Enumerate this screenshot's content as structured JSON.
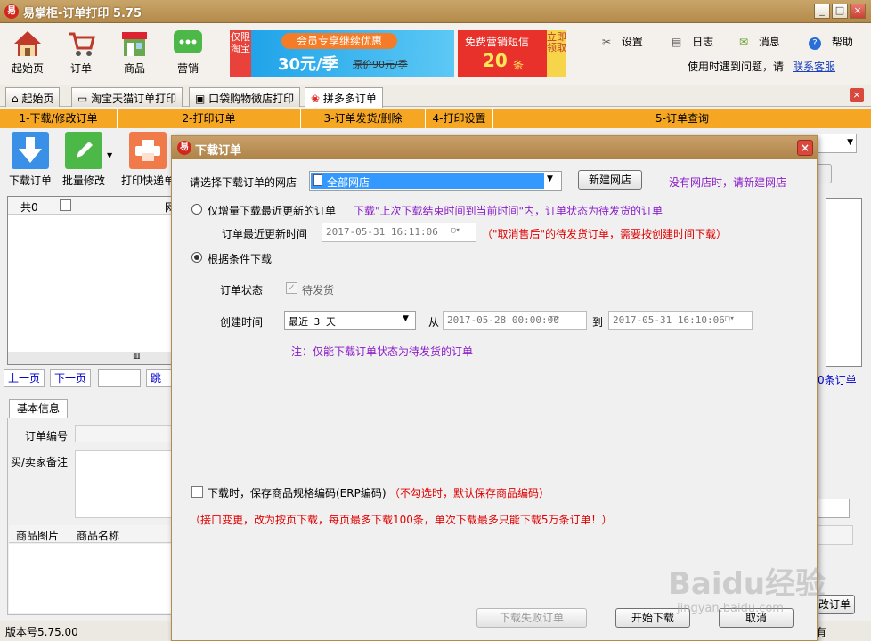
{
  "window": {
    "title": "易掌柜-订单打印 5.75",
    "logo": "易"
  },
  "toolbar": {
    "items": [
      {
        "label": "起始页",
        "icon": "house-icon"
      },
      {
        "label": "订单",
        "icon": "cart-icon"
      },
      {
        "label": "商品",
        "icon": "shop-icon"
      },
      {
        "label": "营销",
        "icon": "chat-bubble-icon"
      }
    ],
    "ad1": {
      "side": "仅限淘宝",
      "top": "会员专享继续优惠",
      "price": "30元/季",
      "orig": "原价90元/季"
    },
    "ad2": {
      "text": "免费营销短信",
      "count": "20",
      "unit": "条",
      "side": "立即领取"
    },
    "menu": {
      "settings": "设置",
      "log": "日志",
      "message": "消息",
      "help": "帮助"
    },
    "help_text": "使用时遇到问题，请",
    "contact_link": "联系客服"
  },
  "tabs": [
    {
      "label": "起始页"
    },
    {
      "label": "淘宝天猫订单打印"
    },
    {
      "label": "口袋购物微店打印"
    },
    {
      "label": "拼多多订单"
    }
  ],
  "steps": [
    "1-下载/修改订单",
    "2-打印订单",
    "3-订单发货/删除",
    "4-打印设置",
    "5-订单查询"
  ],
  "actions": {
    "download": "下载订单",
    "batch_edit": "批量修改",
    "print_express": "打印快递单"
  },
  "grid": {
    "count": "共0",
    "col2": "网"
  },
  "pager": {
    "prev": "上一页",
    "next": "下一页",
    "jump": "跳转",
    "orders_suffix": "0条订单"
  },
  "info": {
    "tab": "基本信息",
    "order_no": "订单编号",
    "remark": "买/卖家备注",
    "goods_img": "商品图片",
    "goods_name": "商品名称"
  },
  "right_panel": {
    "button_partial": "改订单"
  },
  "dialog": {
    "title": "下载订单",
    "shop_label": "请选择下载订单的网店",
    "shop_value": "全部网店",
    "new_shop_button": "新建网店",
    "no_shop_hint": "没有网店时，请新建网店",
    "opt_incremental": "仅增量下载最近更新的订单",
    "incremental_hint": "下载\"上次下载结束时间到当前时间\"内，订单状态为待发货的订单",
    "update_time_label": "订单最近更新时间",
    "update_time_value": "2017-05-31 16:11:06",
    "cancel_hint": "（\"取消售后\"的待发货订单，需要按创建时间下载）",
    "opt_conditional": "根据条件下载",
    "status_label": "订单状态",
    "status_value": "待发货",
    "create_label": "创建时间",
    "range_value": "最近 3 天",
    "from_label": "从",
    "from_value": "2017-05-28 00:00:00",
    "to_label": "到",
    "to_value": "2017-05-31 16:10:06",
    "note": "注：仅能下载订单状态为待发货的订单",
    "save_erp_label": "下载时，保存商品规格编码(ERP编码)",
    "save_erp_hint": "（不勾选时，默认保存商品编码）",
    "api_note": "（接口变更，改为按页下载，每页最多下载100条，单次下载最多只能下载5万条订单！）",
    "failed_button": "下载失败订单",
    "start_button": "开始下载",
    "cancel_button": "取消"
  },
  "status": {
    "version": "版本号5.75.00",
    "right": "有"
  },
  "watermark": {
    "text": "Baidu经验",
    "sub": "jingyan.baidu.com"
  },
  "colors": {
    "steps": "#f5a623",
    "title": "#b48a4a",
    "accent_blue": "#3a8fe6"
  }
}
